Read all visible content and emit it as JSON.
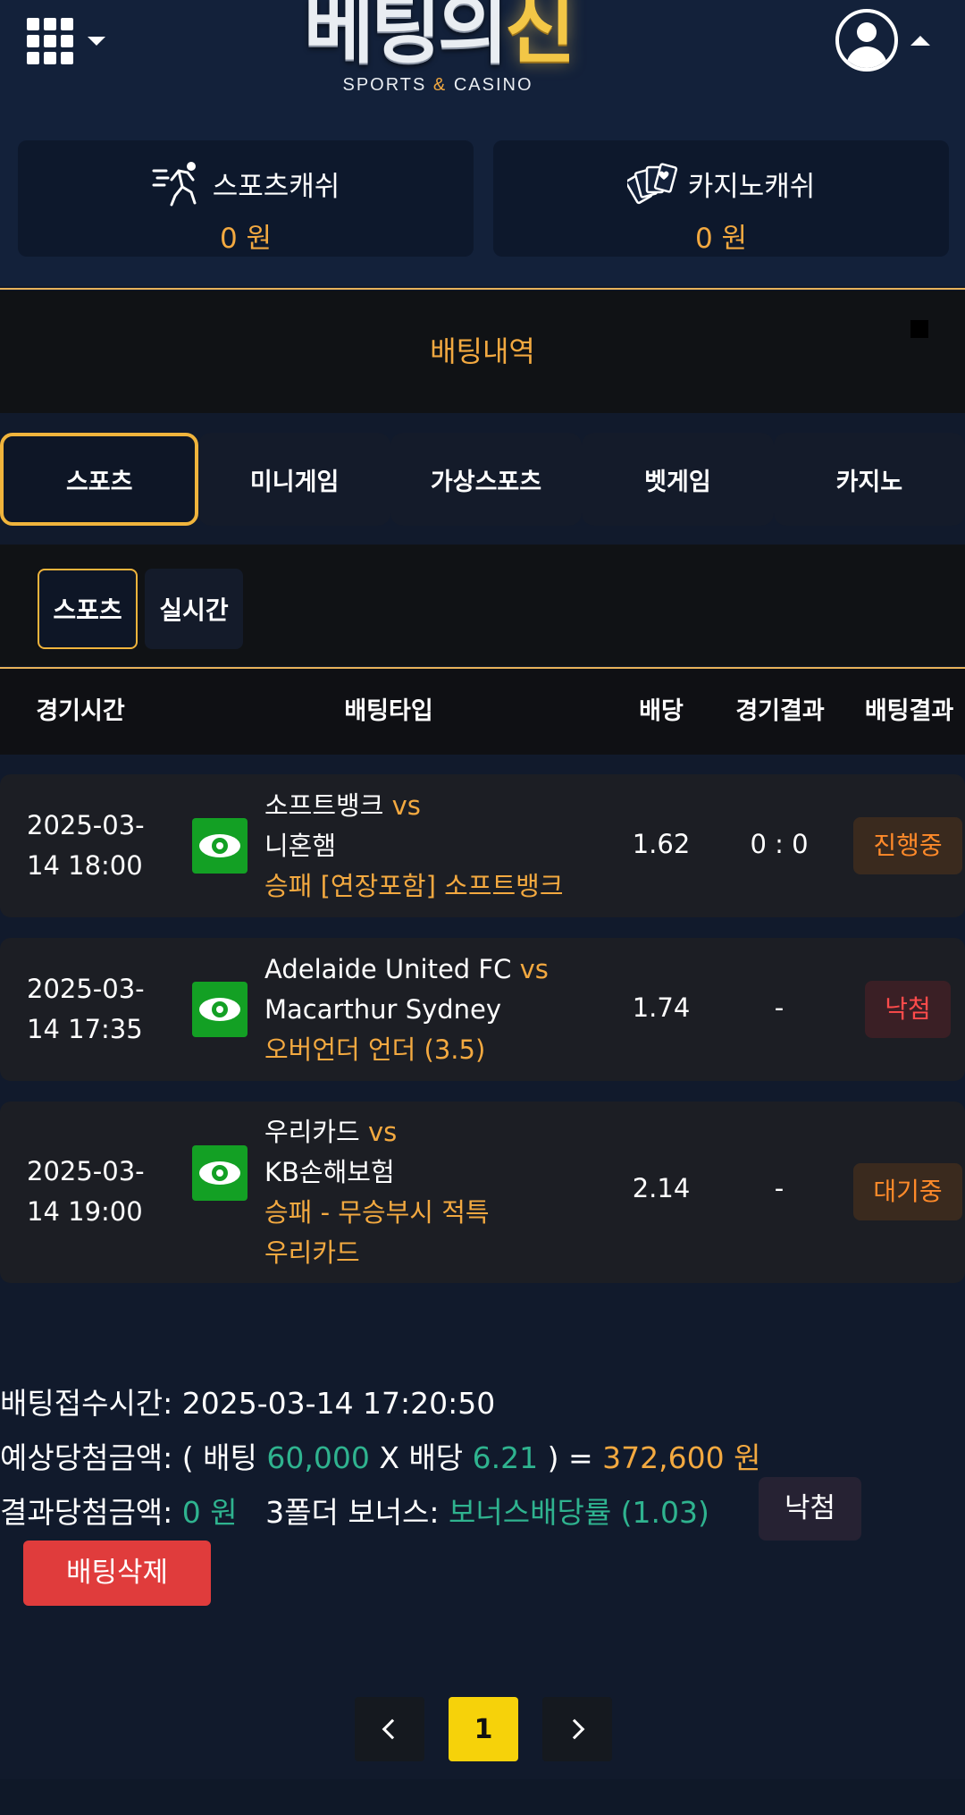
{
  "header": {
    "logo_main_1": "베팅의",
    "logo_main_2": "신",
    "logo_sub_1": "SPORTS",
    "logo_sub_amp": "&",
    "logo_sub_2": "CASINO",
    "menu_icon": "grid-menu-icon",
    "user_icon": "user-circle-icon"
  },
  "cash": {
    "sports": {
      "label": "스포츠캐쉬",
      "amount": "0 원",
      "icon": "running-person-icon"
    },
    "casino": {
      "label": "카지노캐쉬",
      "amount": "0 원",
      "icon": "playing-cards-icon"
    }
  },
  "section_title": "배팅내역",
  "category_tabs": [
    "스포츠",
    "미니게임",
    "가상스포츠",
    "벳게임",
    "카지노"
  ],
  "sub_tabs": [
    "스포츠",
    "실시간"
  ],
  "table": {
    "headers": [
      "경기시간",
      "배팅타입",
      "배당",
      "경기결과",
      "배팅결과"
    ],
    "rows": [
      {
        "time_1": "2025-03-",
        "time_2": "14 18:00",
        "home": "소프트뱅크",
        "vs": "vs",
        "away": "니혼햄",
        "bet_type": "승패 [연장포함] 소프트뱅크",
        "bet_type_2": "",
        "odds": "1.62",
        "score": "0 : 0",
        "result": "진행중"
      },
      {
        "time_1": "2025-03-",
        "time_2": "14 17:35",
        "home": "Adelaide United FC",
        "vs": "vs",
        "away": "Macarthur Sydney",
        "bet_type": "오버언더 언더 (3.5)",
        "bet_type_2": "",
        "odds": "1.74",
        "score": "-",
        "result": "낙첨"
      },
      {
        "time_1": "2025-03-",
        "time_2": "14 19:00",
        "home": "우리카드",
        "vs": "vs",
        "away": "KB손해보험",
        "bet_type": "승패 - 무승부시 적특",
        "bet_type_2": "우리카드",
        "odds": "2.14",
        "score": "-",
        "result": "대기중"
      }
    ]
  },
  "summary": {
    "received_label": "배팅접수시간:",
    "received_value": "2025-03-14 17:20:50",
    "expected_label": "예상당첨금액:",
    "expected_open": "( 배팅",
    "expected_bet": "60,000",
    "expected_x": "X 배당",
    "expected_odds": "6.21",
    "expected_close": ") =",
    "expected_total": "372,600 원",
    "result_label": "결과당첨금액:",
    "result_value": "0 원",
    "bonus_label": "3폴더 보너스:",
    "bonus_value": "보너스배당률 (1.03)",
    "result_status": "낙첨",
    "delete_label": "배팅삭제"
  },
  "pagination": {
    "current": "1"
  },
  "colors": {
    "accent": "#f3a940",
    "gold_border": "#f0b43c",
    "green": "#2fb38f",
    "eye_green": "#13a024",
    "delete_red": "#e03c3c",
    "page_yellow": "#f6d20a"
  }
}
